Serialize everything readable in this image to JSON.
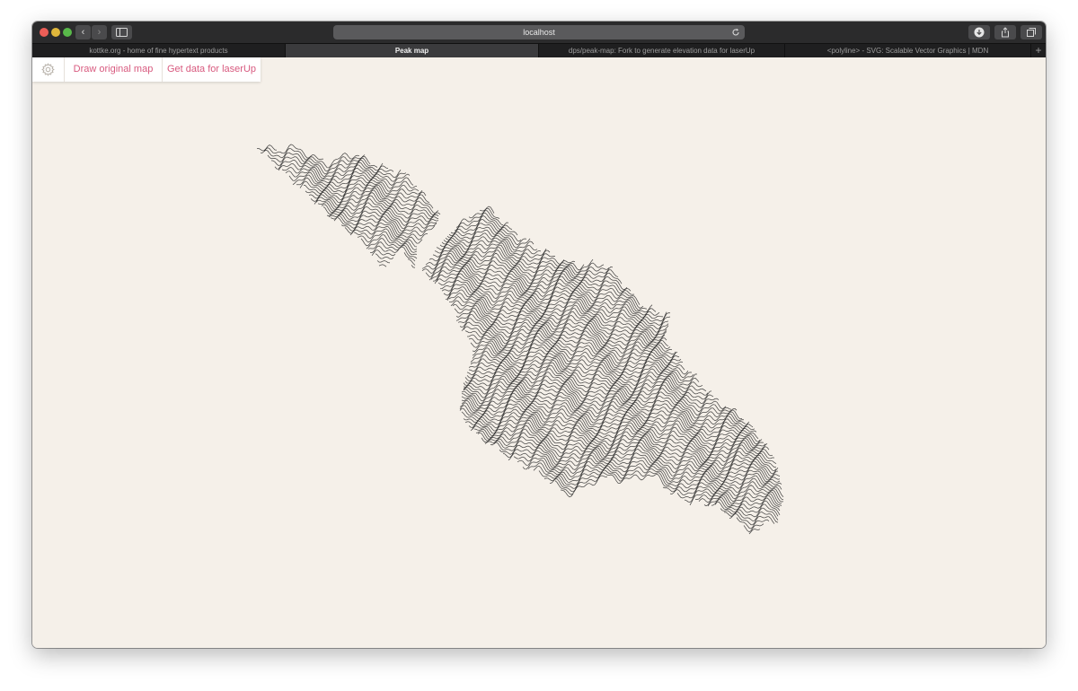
{
  "browser": {
    "url": "localhost",
    "tabs": [
      {
        "label": "kottke.org - home of fine hypertext products",
        "active": false
      },
      {
        "label": "Peak map",
        "active": true
      },
      {
        "label": "dps/peak-map: Fork to generate elevation data for laserUp",
        "active": false
      },
      {
        "label": "<polyline> - SVG: Scalable Vector Graphics | MDN",
        "active": false
      }
    ],
    "new_tab_label": "+"
  },
  "toolbar": {
    "settings_icon": "gear-icon",
    "draw_label": "Draw original map",
    "get_data_label": "Get data for laserUp"
  },
  "colors": {
    "background": "#f5f0e9",
    "accent": "#d85a7f",
    "line": "#2b2b2b"
  }
}
